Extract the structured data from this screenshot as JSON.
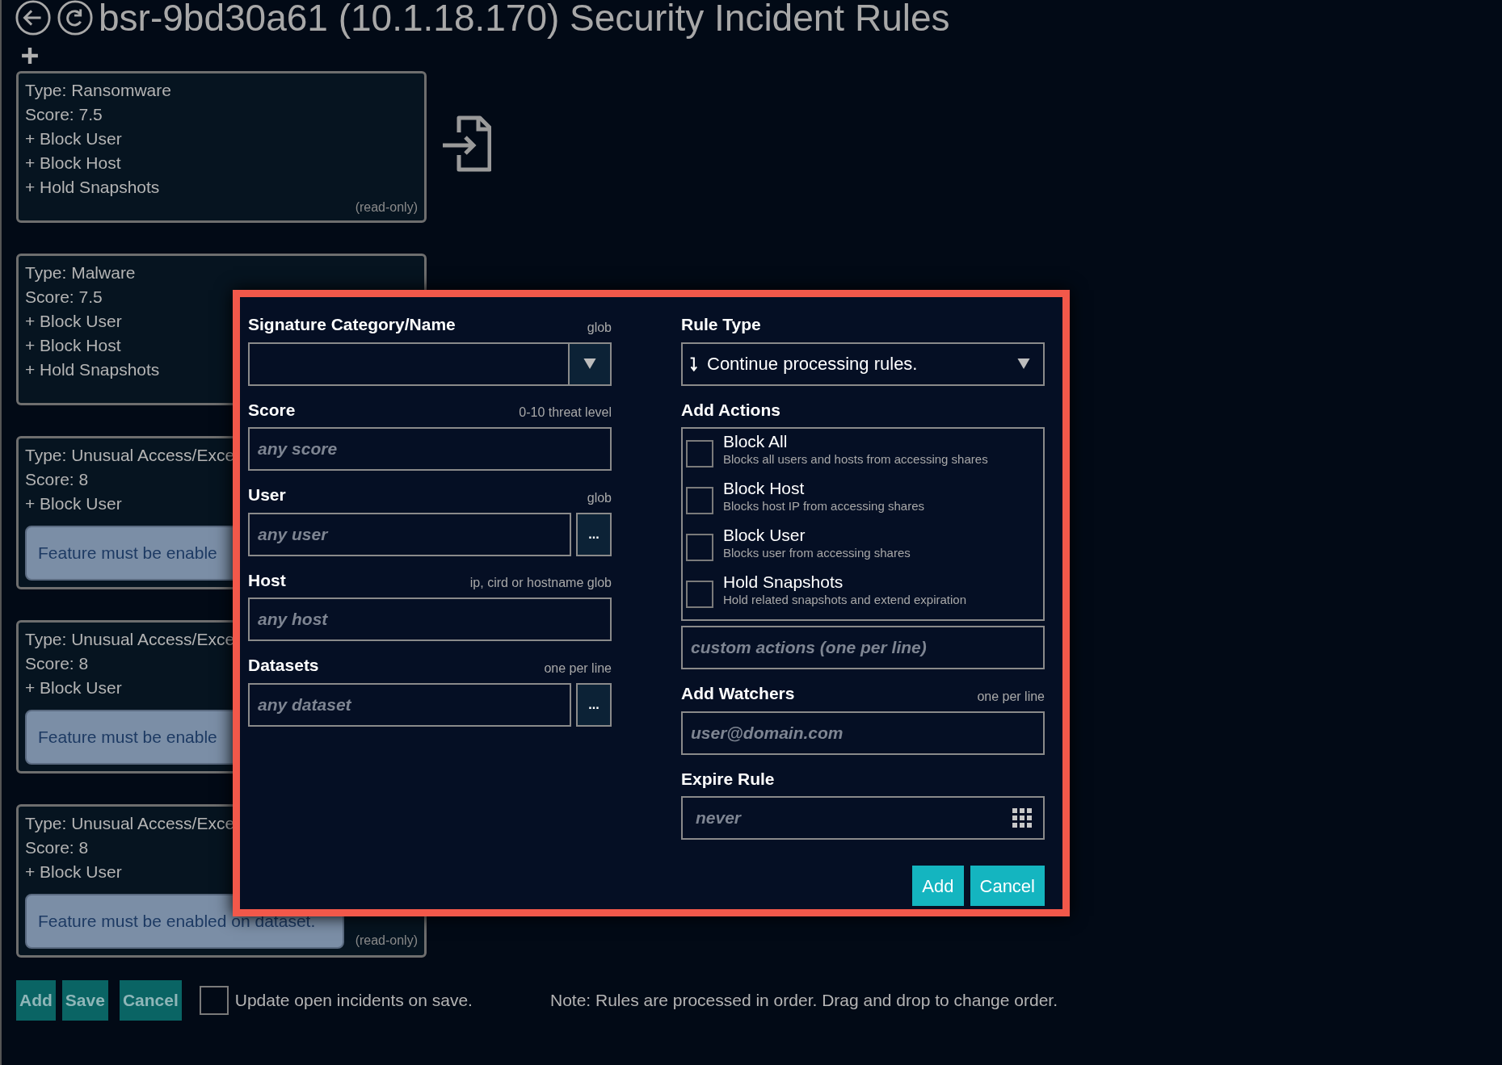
{
  "header": {
    "title": "bsr-9bd30a61 (10.1.18.170) Security Incident Rules"
  },
  "rules": [
    {
      "type": "Type: Ransomware",
      "score": "Score: 7.5",
      "actions": [
        "+ Block User",
        "+ Block Host",
        "+ Hold Snapshots"
      ],
      "footnote": "(read-only)"
    },
    {
      "type": "Type: Malware",
      "score": "Score: 7.5",
      "actions": [
        "+ Block User",
        "+ Block Host",
        "+ Hold Snapshots"
      ]
    },
    {
      "type": "Type: Unusual Access/Exce",
      "score": "Score: 8",
      "actions": [
        "+ Block User"
      ],
      "notice": "Feature must be enable"
    },
    {
      "type": "Type: Unusual Access/Exce",
      "score": "Score: 8",
      "actions": [
        "+ Block User"
      ],
      "notice": "Feature must be enable"
    },
    {
      "type": "Type: Unusual Access/Exce",
      "score": "Score: 8",
      "actions": [
        "+ Block User"
      ],
      "notice": "Feature must be enabled on dataset.",
      "footnote": "(read-only)"
    }
  ],
  "dialog": {
    "fields": [
      {
        "kind": "select",
        "label": "Signature Category/Name",
        "hint": "glob"
      },
      {
        "kind": "text",
        "label": "Score",
        "hint": "0-10 threat level",
        "placeholder": "any score"
      },
      {
        "kind": "picker",
        "label": "User",
        "hint": "glob",
        "placeholder": "any user",
        "button": "..."
      },
      {
        "kind": "text",
        "label": "Host",
        "hint": "ip, cird or hostname glob",
        "placeholder": "any host"
      },
      {
        "kind": "picker",
        "label": "Datasets",
        "hint": "one per line",
        "placeholder": "any dataset",
        "button": "..."
      }
    ],
    "rule_type": {
      "label": "Rule Type",
      "value": "Continue processing rules."
    },
    "actions": {
      "label": "Add Actions",
      "items": [
        {
          "title": "Block All",
          "description": "Blocks all users and hosts from accessing shares",
          "checked": false
        },
        {
          "title": "Block Host",
          "description": "Blocks host IP from accessing shares",
          "checked": false
        },
        {
          "title": "Block User",
          "description": "Blocks user from accessing shares",
          "checked": false
        },
        {
          "title": "Hold Snapshots",
          "description": "Hold related snapshots and extend expiration",
          "checked": false
        }
      ],
      "custom_placeholder": "custom actions (one per line)"
    },
    "watchers": {
      "label": "Add Watchers",
      "hint": "one per line",
      "placeholder": "user@domain.com"
    },
    "expire": {
      "label": "Expire Rule",
      "placeholder": "never"
    },
    "buttons": [
      "Add",
      "Cancel"
    ]
  },
  "footer": {
    "buttons": [
      "Add",
      "Save",
      "Cancel"
    ],
    "update_option": {
      "label": "Update open incidents on save.",
      "checked": false
    },
    "note": "Note: Rules are processed in order. Drag and drop to change order."
  }
}
